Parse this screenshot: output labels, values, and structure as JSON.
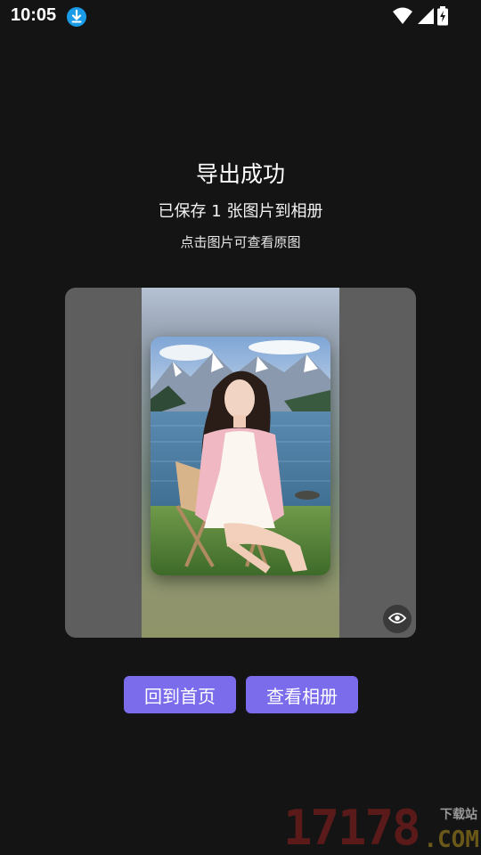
{
  "status_bar": {
    "time": "10:05",
    "download_icon": "download-icon",
    "wifi_icon": "wifi-icon",
    "signal_icon": "signal-icon",
    "battery_icon": "battery-charging-icon"
  },
  "header": {
    "title": "导出成功",
    "subtitle": "已保存 1 张图片到相册",
    "hint": "点击图片可查看原图"
  },
  "preview": {
    "view_icon": "eye-icon"
  },
  "actions": {
    "home_label": "回到首页",
    "album_label": "查看相册"
  },
  "watermark": {
    "number": "17178",
    "tag": "下载站",
    "domain": ".COM"
  },
  "colors": {
    "background": "#141414",
    "accent": "#7b6cec",
    "preview_bg": "#5e5e5e"
  }
}
